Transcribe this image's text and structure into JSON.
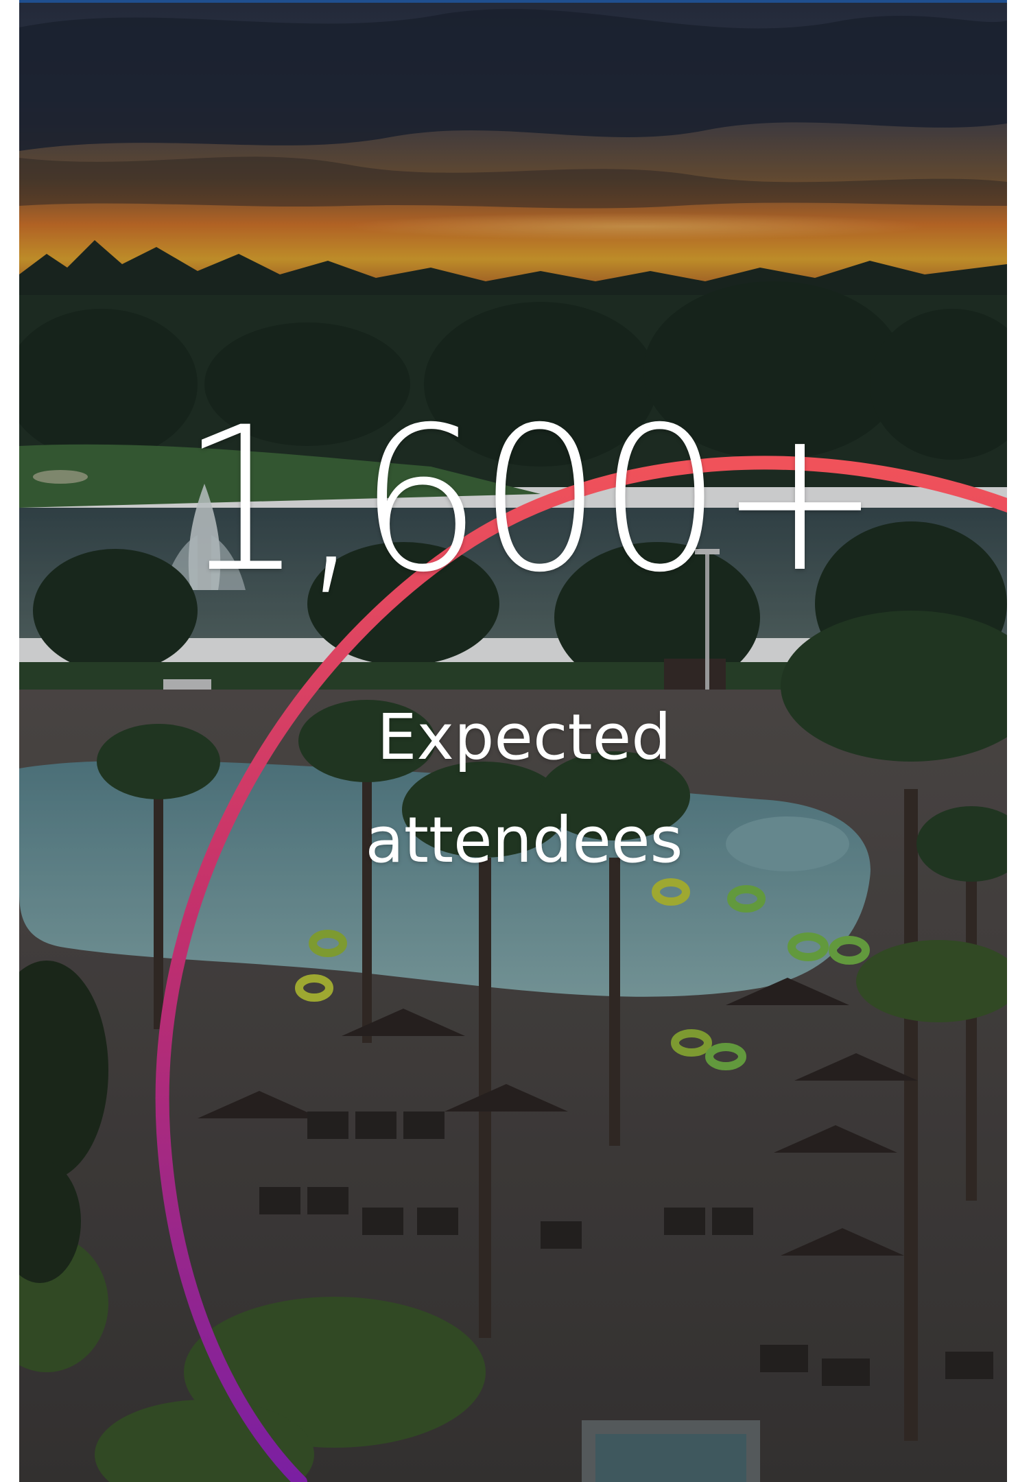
{
  "stat": {
    "value": "1,600+",
    "label_line1": "Expected",
    "label_line2": "attendees"
  },
  "colors": {
    "arc_start": "#f0525a",
    "arc_mid": "#c2306c",
    "arc_end": "#7a1fa2",
    "text": "#ffffff",
    "top_border": "#1f4f8f"
  },
  "background": {
    "subject": "resort pool at sunset",
    "icon": "photo-background"
  }
}
